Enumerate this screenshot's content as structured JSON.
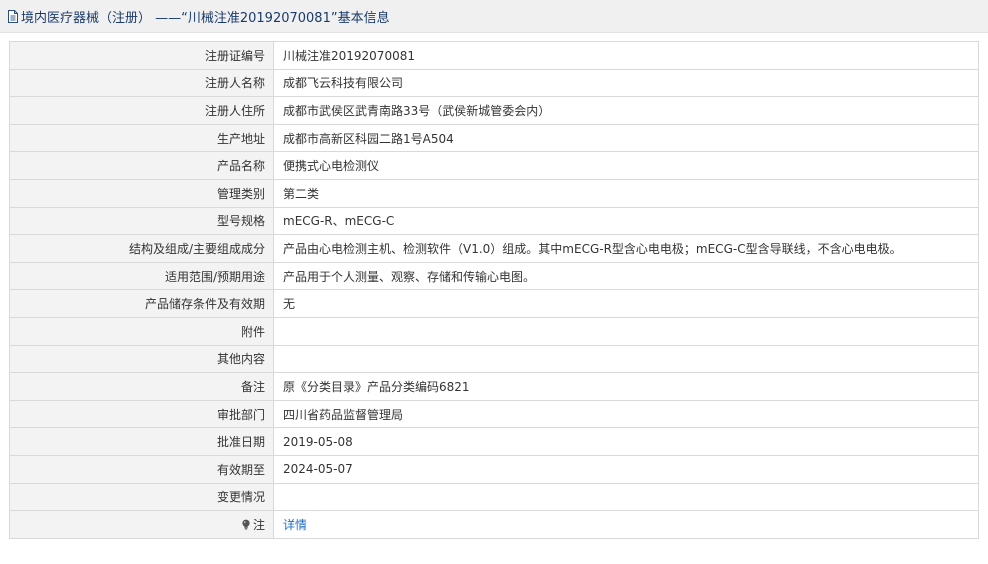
{
  "header": {
    "icon": "document-icon",
    "title": "境内医疗器械（注册） ——“川械注准20192070081”基本信息"
  },
  "rows": [
    {
      "key": "registration-number",
      "label": "注册证编号",
      "value": "川械注准20192070081"
    },
    {
      "key": "registrant-name",
      "label": "注册人名称",
      "value": "成都飞云科技有限公司"
    },
    {
      "key": "registrant-address",
      "label": "注册人住所",
      "value": "成都市武侯区武青南路33号（武侯新城管委会内）"
    },
    {
      "key": "production-address",
      "label": "生产地址",
      "value": "成都市高新区科园二路1号A504"
    },
    {
      "key": "product-name",
      "label": "产品名称",
      "value": "便携式心电检测仪"
    },
    {
      "key": "management-class",
      "label": "管理类别",
      "value": "第二类"
    },
    {
      "key": "model-spec",
      "label": "型号规格",
      "value": "mECG-R、mECG-C"
    },
    {
      "key": "structure-composition",
      "label": "结构及组成/主要组成成分",
      "value": "产品由心电检测主机、检测软件（V1.0）组成。其中mECG-R型含心电电极；mECG-C型含导联线，不含心电电极。"
    },
    {
      "key": "intended-use",
      "label": "适用范围/预期用途",
      "value": "产品用于个人测量、观察、存储和传输心电图。"
    },
    {
      "key": "storage-validity",
      "label": "产品储存条件及有效期",
      "value": "无"
    },
    {
      "key": "attachment",
      "label": "附件",
      "value": ""
    },
    {
      "key": "other-content",
      "label": "其他内容",
      "value": ""
    },
    {
      "key": "remarks",
      "label": "备注",
      "value": "原《分类目录》产品分类编码6821"
    },
    {
      "key": "approval-department",
      "label": "审批部门",
      "value": "四川省药品监督管理局"
    },
    {
      "key": "approval-date",
      "label": "批准日期",
      "value": "2019-05-08"
    },
    {
      "key": "valid-until",
      "label": "有效期至",
      "value": "2024-05-07"
    },
    {
      "key": "change-status",
      "label": "变更情况",
      "value": ""
    }
  ],
  "note_row": {
    "icon": "lightbulb-icon",
    "label": "注",
    "link_text": "详情",
    "link_color": "#1f6fbf"
  }
}
